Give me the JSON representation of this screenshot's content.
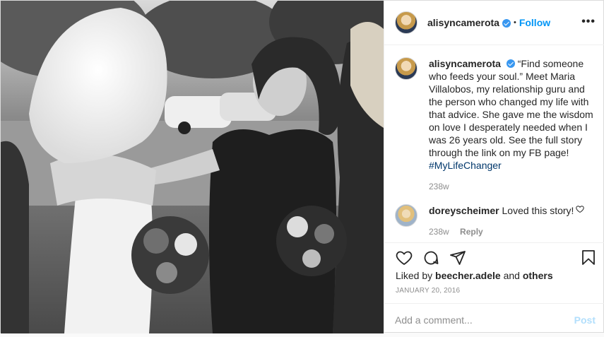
{
  "header": {
    "username": "alisyncamerota",
    "separator": "•",
    "follow_label": "Follow",
    "more_icon": "more-horizontal-icon"
  },
  "caption": {
    "username": "alisyncamerota",
    "text": "“Find someone who feeds your soul.” Meet Maria Villalobos, my relationship guru and the person who changed my life with that advice. She gave me the wisdom on love I desperately needed when I was 26 years old. See the full story through the link on my FB page!",
    "hashtag": "#MyLifeChanger",
    "age": "238w"
  },
  "comments": [
    {
      "username": "doreyscheimer",
      "text": "Loved this story!",
      "age": "238w",
      "reply_label": "Reply"
    }
  ],
  "actions": {
    "icons": [
      "heart-icon",
      "comment-icon",
      "share-icon",
      "bookmark-icon"
    ],
    "liked_by_prefix": "Liked by",
    "liked_by_user": "beecher.adele",
    "liked_by_and": "and",
    "liked_by_others": "others",
    "date": "JANUARY 20, 2016"
  },
  "add_comment": {
    "placeholder": "Add a comment...",
    "post_label": "Post"
  },
  "colors": {
    "link": "#0095f6",
    "hashtag": "#00376b",
    "muted": "#8e8e8e",
    "post_disabled": "#b2dffc"
  }
}
